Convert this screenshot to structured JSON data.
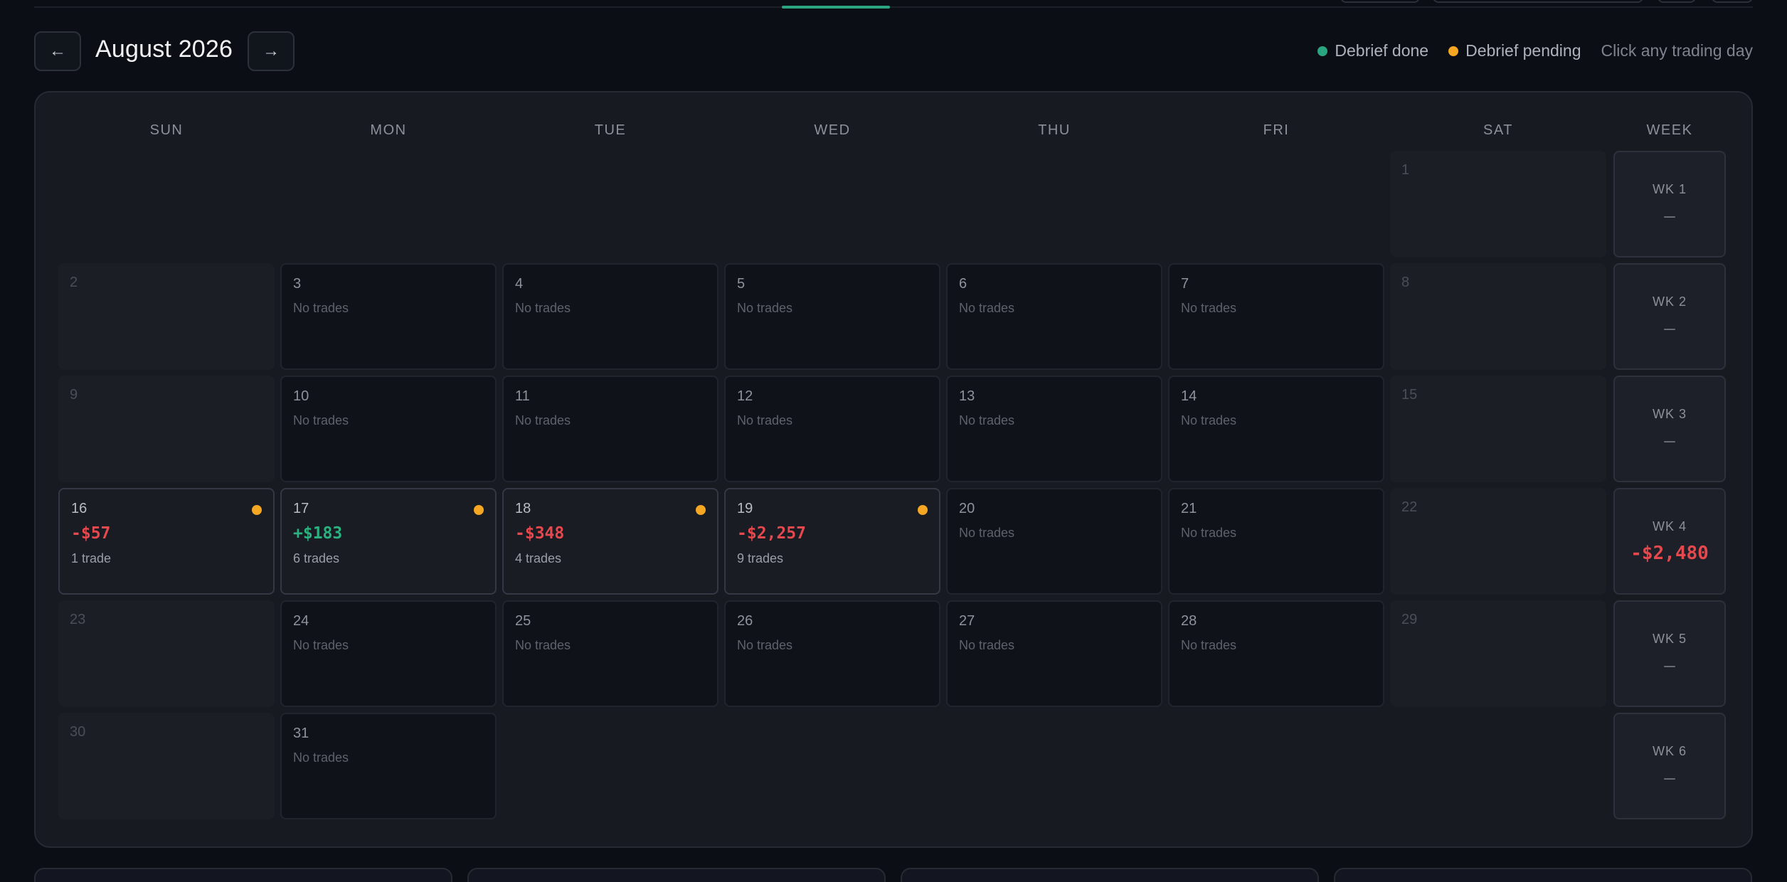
{
  "header": {
    "prev_icon": "arrow-left-icon",
    "next_icon": "arrow-right-icon",
    "prev_glyph": "←",
    "next_glyph": "→",
    "month_title": "August 2026"
  },
  "legend": {
    "done_label": "Debrief done",
    "pending_label": "Debrief pending",
    "hint": "Click any trading day"
  },
  "colors": {
    "done": "#2aa57f",
    "pending": "#f5a623",
    "positive": "#2bb07f",
    "negative": "#e5484d"
  },
  "calendar": {
    "day_headers": [
      "SUN",
      "MON",
      "TUE",
      "WED",
      "THU",
      "FRI",
      "SAT"
    ],
    "week_header": "WEEK",
    "no_trades_label": "No trades",
    "weeks": [
      {
        "label": "WK 1",
        "total": "—",
        "total_sign": "none",
        "days": [
          null,
          null,
          null,
          null,
          null,
          null,
          {
            "num": "1",
            "kind": "empty"
          }
        ]
      },
      {
        "label": "WK 2",
        "total": "—",
        "total_sign": "none",
        "days": [
          {
            "num": "2",
            "kind": "empty"
          },
          {
            "num": "3",
            "kind": "active"
          },
          {
            "num": "4",
            "kind": "active"
          },
          {
            "num": "5",
            "kind": "active"
          },
          {
            "num": "6",
            "kind": "active"
          },
          {
            "num": "7",
            "kind": "active"
          },
          {
            "num": "8",
            "kind": "empty"
          }
        ]
      },
      {
        "label": "WK 3",
        "total": "—",
        "total_sign": "none",
        "days": [
          {
            "num": "9",
            "kind": "empty"
          },
          {
            "num": "10",
            "kind": "active"
          },
          {
            "num": "11",
            "kind": "active"
          },
          {
            "num": "12",
            "kind": "active"
          },
          {
            "num": "13",
            "kind": "active"
          },
          {
            "num": "14",
            "kind": "active"
          },
          {
            "num": "15",
            "kind": "empty"
          }
        ]
      },
      {
        "label": "WK 4",
        "total": "-$2,480",
        "total_sign": "neg",
        "days": [
          {
            "num": "16",
            "kind": "traded",
            "pnl": "-$57",
            "sign": "neg",
            "trades": "1 trade",
            "status": "pending"
          },
          {
            "num": "17",
            "kind": "traded",
            "pnl": "+$183",
            "sign": "pos",
            "trades": "6 trades",
            "status": "pending"
          },
          {
            "num": "18",
            "kind": "traded",
            "pnl": "-$348",
            "sign": "neg",
            "trades": "4 trades",
            "status": "pending"
          },
          {
            "num": "19",
            "kind": "traded",
            "pnl": "-$2,257",
            "sign": "neg",
            "trades": "9 trades",
            "status": "pending"
          },
          {
            "num": "20",
            "kind": "active"
          },
          {
            "num": "21",
            "kind": "active"
          },
          {
            "num": "22",
            "kind": "empty"
          }
        ]
      },
      {
        "label": "WK 5",
        "total": "—",
        "total_sign": "none",
        "days": [
          {
            "num": "23",
            "kind": "empty"
          },
          {
            "num": "24",
            "kind": "active"
          },
          {
            "num": "25",
            "kind": "active"
          },
          {
            "num": "26",
            "kind": "active"
          },
          {
            "num": "27",
            "kind": "active"
          },
          {
            "num": "28",
            "kind": "active"
          },
          {
            "num": "29",
            "kind": "empty"
          }
        ]
      },
      {
        "label": "WK 6",
        "total": "—",
        "total_sign": "none",
        "days": [
          {
            "num": "30",
            "kind": "empty"
          },
          {
            "num": "31",
            "kind": "active"
          },
          null,
          null,
          null,
          null,
          null
        ]
      }
    ]
  }
}
